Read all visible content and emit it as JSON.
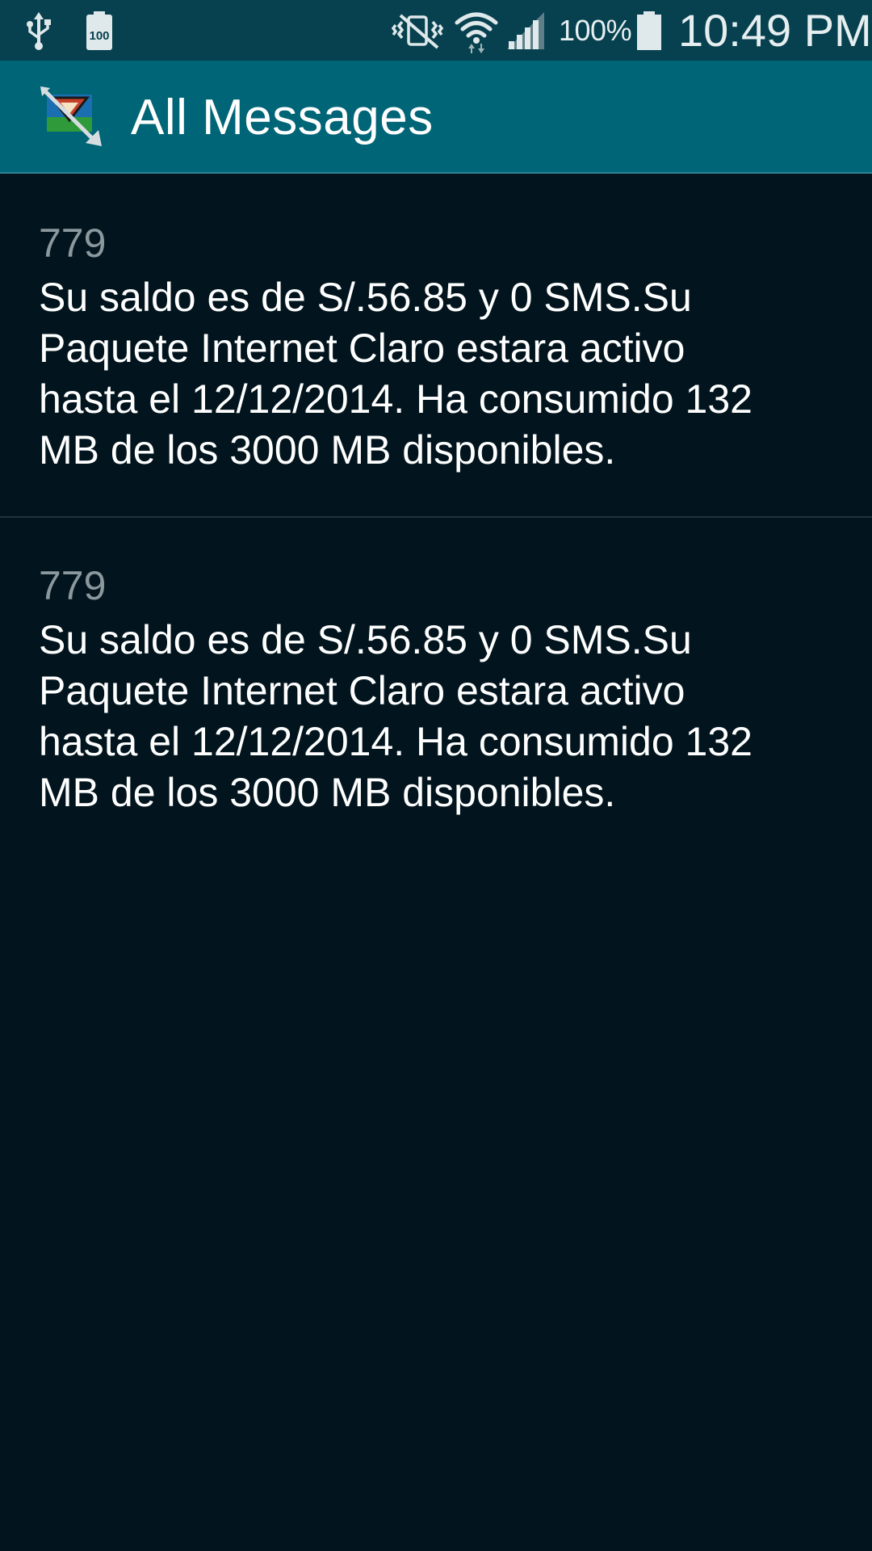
{
  "status_bar": {
    "battery_saver_label": "100",
    "battery_percent": "100%",
    "time": "10:49 PM",
    "icons": [
      "usb-icon",
      "battery-100-icon",
      "vibrate-icon",
      "wifi-icon",
      "signal-icon",
      "battery-icon"
    ],
    "battery_level": 1.0,
    "signal_level": 0.8
  },
  "header": {
    "title": "All Messages"
  },
  "messages": [
    {
      "sender": "779",
      "body": "Su saldo es de S/.56.85 y 0 SMS.Su\nPaquete Internet Claro estara activo\nhasta el 12/12/2014. Ha consumido 132\nMB de los 3000 MB disponibles."
    },
    {
      "sender": "779",
      "body": "Su saldo es de S/.56.85 y 0 SMS.Su\nPaquete Internet Claro estara activo\nhasta el 12/12/2014. Ha consumido 132\nMB de los 3000 MB disponibles."
    }
  ],
  "colors": {
    "status_bar_bg": "#07414f",
    "action_bar_bg": "#006577",
    "content_bg": "#02151e",
    "sender_text": "#8b989d",
    "body_text": "#ffffff"
  }
}
